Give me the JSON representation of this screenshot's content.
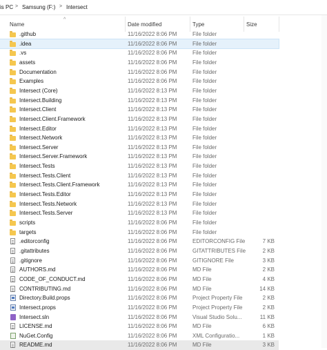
{
  "address_bar": {
    "crumbs": [
      "is PC",
      "Samsung (F:)",
      "Intersect"
    ],
    "separator": ">"
  },
  "columns": {
    "name": "Name",
    "date": "Date modified",
    "type": "Type",
    "size": "Size"
  },
  "rows": [
    {
      "name": ".github",
      "date": "11/16/2022 8:06 PM",
      "type": "File folder",
      "size": "",
      "icon": "folder-icon"
    },
    {
      "name": ".idea",
      "date": "11/16/2022 8:06 PM",
      "type": "File folder",
      "size": "",
      "icon": "folder-icon"
    },
    {
      "name": ".vs",
      "date": "11/16/2022 8:06 PM",
      "type": "File folder",
      "size": "",
      "icon": "folder-icon"
    },
    {
      "name": "assets",
      "date": "11/16/2022 8:06 PM",
      "type": "File folder",
      "size": "",
      "icon": "folder-icon"
    },
    {
      "name": "Documentation",
      "date": "11/16/2022 8:06 PM",
      "type": "File folder",
      "size": "",
      "icon": "folder-icon"
    },
    {
      "name": "Examples",
      "date": "11/16/2022 8:06 PM",
      "type": "File folder",
      "size": "",
      "icon": "folder-icon"
    },
    {
      "name": "Intersect (Core)",
      "date": "11/16/2022 8:13 PM",
      "type": "File folder",
      "size": "",
      "icon": "folder-icon"
    },
    {
      "name": "Intersect.Building",
      "date": "11/16/2022 8:13 PM",
      "type": "File folder",
      "size": "",
      "icon": "folder-icon"
    },
    {
      "name": "Intersect.Client",
      "date": "11/16/2022 8:13 PM",
      "type": "File folder",
      "size": "",
      "icon": "folder-icon"
    },
    {
      "name": "Intersect.Client.Framework",
      "date": "11/16/2022 8:13 PM",
      "type": "File folder",
      "size": "",
      "icon": "folder-icon"
    },
    {
      "name": "Intersect.Editor",
      "date": "11/16/2022 8:13 PM",
      "type": "File folder",
      "size": "",
      "icon": "folder-icon"
    },
    {
      "name": "Intersect.Network",
      "date": "11/16/2022 8:13 PM",
      "type": "File folder",
      "size": "",
      "icon": "folder-icon"
    },
    {
      "name": "Intersect.Server",
      "date": "11/16/2022 8:13 PM",
      "type": "File folder",
      "size": "",
      "icon": "folder-icon"
    },
    {
      "name": "Intersect.Server.Framework",
      "date": "11/16/2022 8:13 PM",
      "type": "File folder",
      "size": "",
      "icon": "folder-icon"
    },
    {
      "name": "Intersect.Tests",
      "date": "11/16/2022 8:13 PM",
      "type": "File folder",
      "size": "",
      "icon": "folder-icon"
    },
    {
      "name": "Intersect.Tests.Client",
      "date": "11/16/2022 8:13 PM",
      "type": "File folder",
      "size": "",
      "icon": "folder-icon"
    },
    {
      "name": "Intersect.Tests.Client.Framework",
      "date": "11/16/2022 8:13 PM",
      "type": "File folder",
      "size": "",
      "icon": "folder-icon"
    },
    {
      "name": "Intersect.Tests.Editor",
      "date": "11/16/2022 8:13 PM",
      "type": "File folder",
      "size": "",
      "icon": "folder-icon"
    },
    {
      "name": "Intersect.Tests.Network",
      "date": "11/16/2022 8:13 PM",
      "type": "File folder",
      "size": "",
      "icon": "folder-icon"
    },
    {
      "name": "Intersect.Tests.Server",
      "date": "11/16/2022 8:13 PM",
      "type": "File folder",
      "size": "",
      "icon": "folder-icon"
    },
    {
      "name": "scripts",
      "date": "11/16/2022 8:06 PM",
      "type": "File folder",
      "size": "",
      "icon": "folder-icon"
    },
    {
      "name": "targets",
      "date": "11/16/2022 8:06 PM",
      "type": "File folder",
      "size": "",
      "icon": "folder-icon"
    },
    {
      "name": ".editorconfig",
      "date": "11/16/2022 8:06 PM",
      "type": "EDITORCONFIG File",
      "size": "7 KB",
      "icon": "file-icon"
    },
    {
      "name": ".gitattributes",
      "date": "11/16/2022 8:06 PM",
      "type": "GITATTRIBUTES File",
      "size": "2 KB",
      "icon": "file-icon"
    },
    {
      "name": ".gitignore",
      "date": "11/16/2022 8:06 PM",
      "type": "GITIGNORE File",
      "size": "3 KB",
      "icon": "file-icon"
    },
    {
      "name": "AUTHORS.md",
      "date": "11/16/2022 8:06 PM",
      "type": "MD File",
      "size": "2 KB",
      "icon": "file-icon"
    },
    {
      "name": "CODE_OF_CONDUCT.md",
      "date": "11/16/2022 8:06 PM",
      "type": "MD File",
      "size": "4 KB",
      "icon": "file-icon"
    },
    {
      "name": "CONTRIBUTING.md",
      "date": "11/16/2022 8:06 PM",
      "type": "MD File",
      "size": "14 KB",
      "icon": "file-icon"
    },
    {
      "name": "Directory.Build.props",
      "date": "11/16/2022 8:06 PM",
      "type": "Project Property File",
      "size": "2 KB",
      "icon": "project-icon"
    },
    {
      "name": "Intersect.props",
      "date": "11/16/2022 8:06 PM",
      "type": "Project Property File",
      "size": "2 KB",
      "icon": "project-icon"
    },
    {
      "name": "Intersect.sln",
      "date": "11/16/2022 8:06 PM",
      "type": "Visual Studio Solu...",
      "size": "11 KB",
      "icon": "solution-icon"
    },
    {
      "name": "LICENSE.md",
      "date": "11/16/2022 8:06 PM",
      "type": "MD File",
      "size": "6 KB",
      "icon": "file-icon"
    },
    {
      "name": "NuGet.Config",
      "date": "11/16/2022 8:06 PM",
      "type": "XML Configuratio...",
      "size": "1 KB",
      "icon": "config-icon"
    },
    {
      "name": "README.md",
      "date": "11/16/2022 8:06 PM",
      "type": "MD File",
      "size": "3 KB",
      "icon": "file-icon"
    }
  ],
  "selected_row": 1
}
